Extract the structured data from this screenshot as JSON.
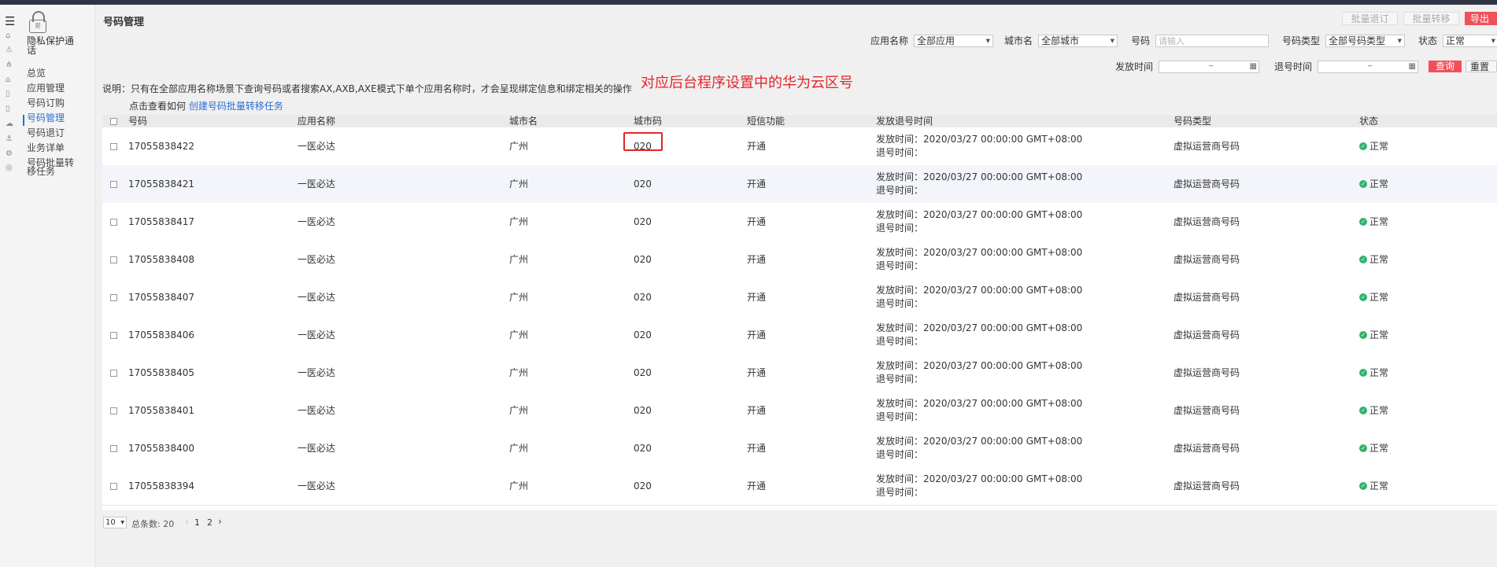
{
  "app": {
    "name": "隐私保护通话",
    "logo_text": "密"
  },
  "sidebar": {
    "items": [
      {
        "label": "总览"
      },
      {
        "label": "应用管理"
      },
      {
        "label": "号码订购"
      },
      {
        "label": "号码管理"
      },
      {
        "label": "号码退订"
      },
      {
        "label": "业务详单"
      },
      {
        "label": "号码批量转移任务"
      }
    ],
    "active": "号码管理"
  },
  "header": {
    "title": "号码管理",
    "buttons": {
      "batch_unsub": "批量退订",
      "batch_transfer": "批量转移",
      "export": "导出"
    }
  },
  "filters": {
    "app_name_label": "应用名称",
    "app_name_value": "全部应用",
    "city_label": "城市名",
    "city_value": "全部城市",
    "number_label": "号码",
    "number_placeholder": "请输入",
    "type_label": "号码类型",
    "type_value": "全部号码类型",
    "status_label": "状态",
    "status_value": "正常",
    "release_time_label": "发放时间",
    "unsub_time_label": "退号时间",
    "query_label": "查询",
    "reset_label": "重置"
  },
  "notice": {
    "text": "说明：只有在全部应用名称场景下查询号码或者搜索AX,AXB,AXE模式下单个应用名称时，才会呈现绑定信息和绑定相关的操作",
    "click_text": "点击查看如何",
    "link_text": "创建号码批量转移任务"
  },
  "annotation": "对应后台程序设置中的华为云区号",
  "table": {
    "columns": [
      "号码",
      "应用名称",
      "城市名",
      "城市码",
      "短信功能",
      "发放退号时间",
      "号码类型",
      "状态"
    ],
    "rows": [
      {
        "number": "17055838422",
        "app": "一医必达",
        "city": "广州",
        "code": "020",
        "sms": "开通",
        "release": "发放时间：2020/03/27 00:00:00 GMT+08:00",
        "unsub": "退号时间：",
        "type": "虚拟运营商号码",
        "status": "正常"
      },
      {
        "number": "17055838421",
        "app": "一医必达",
        "city": "广州",
        "code": "020",
        "sms": "开通",
        "release": "发放时间：2020/03/27 00:00:00 GMT+08:00",
        "unsub": "退号时间：",
        "type": "虚拟运营商号码",
        "status": "正常"
      },
      {
        "number": "17055838417",
        "app": "一医必达",
        "city": "广州",
        "code": "020",
        "sms": "开通",
        "release": "发放时间：2020/03/27 00:00:00 GMT+08:00",
        "unsub": "退号时间：",
        "type": "虚拟运营商号码",
        "status": "正常"
      },
      {
        "number": "17055838408",
        "app": "一医必达",
        "city": "广州",
        "code": "020",
        "sms": "开通",
        "release": "发放时间：2020/03/27 00:00:00 GMT+08:00",
        "unsub": "退号时间：",
        "type": "虚拟运营商号码",
        "status": "正常"
      },
      {
        "number": "17055838407",
        "app": "一医必达",
        "city": "广州",
        "code": "020",
        "sms": "开通",
        "release": "发放时间：2020/03/27 00:00:00 GMT+08:00",
        "unsub": "退号时间：",
        "type": "虚拟运营商号码",
        "status": "正常"
      },
      {
        "number": "17055838406",
        "app": "一医必达",
        "city": "广州",
        "code": "020",
        "sms": "开通",
        "release": "发放时间：2020/03/27 00:00:00 GMT+08:00",
        "unsub": "退号时间：",
        "type": "虚拟运营商号码",
        "status": "正常"
      },
      {
        "number": "17055838405",
        "app": "一医必达",
        "city": "广州",
        "code": "020",
        "sms": "开通",
        "release": "发放时间：2020/03/27 00:00:00 GMT+08:00",
        "unsub": "退号时间：",
        "type": "虚拟运营商号码",
        "status": "正常"
      },
      {
        "number": "17055838401",
        "app": "一医必达",
        "city": "广州",
        "code": "020",
        "sms": "开通",
        "release": "发放时间：2020/03/27 00:00:00 GMT+08:00",
        "unsub": "退号时间：",
        "type": "虚拟运营商号码",
        "status": "正常"
      },
      {
        "number": "17055838400",
        "app": "一医必达",
        "city": "广州",
        "code": "020",
        "sms": "开通",
        "release": "发放时间：2020/03/27 00:00:00 GMT+08:00",
        "unsub": "退号时间：",
        "type": "虚拟运营商号码",
        "status": "正常"
      },
      {
        "number": "17055838394",
        "app": "一医必达",
        "city": "广州",
        "code": "020",
        "sms": "开通",
        "release": "发放时间：2020/03/27 00:00:00 GMT+08:00",
        "unsub": "退号时间：",
        "type": "虚拟运营商号码",
        "status": "正常"
      }
    ]
  },
  "pagination": {
    "page_size": "10",
    "total_text": "总条数: 20",
    "pages": [
      "1",
      "2"
    ]
  },
  "colors": {
    "accent": "#2a6fd6",
    "danger": "#f0505a",
    "annotation": "#e3252a",
    "success": "#31b36b"
  }
}
